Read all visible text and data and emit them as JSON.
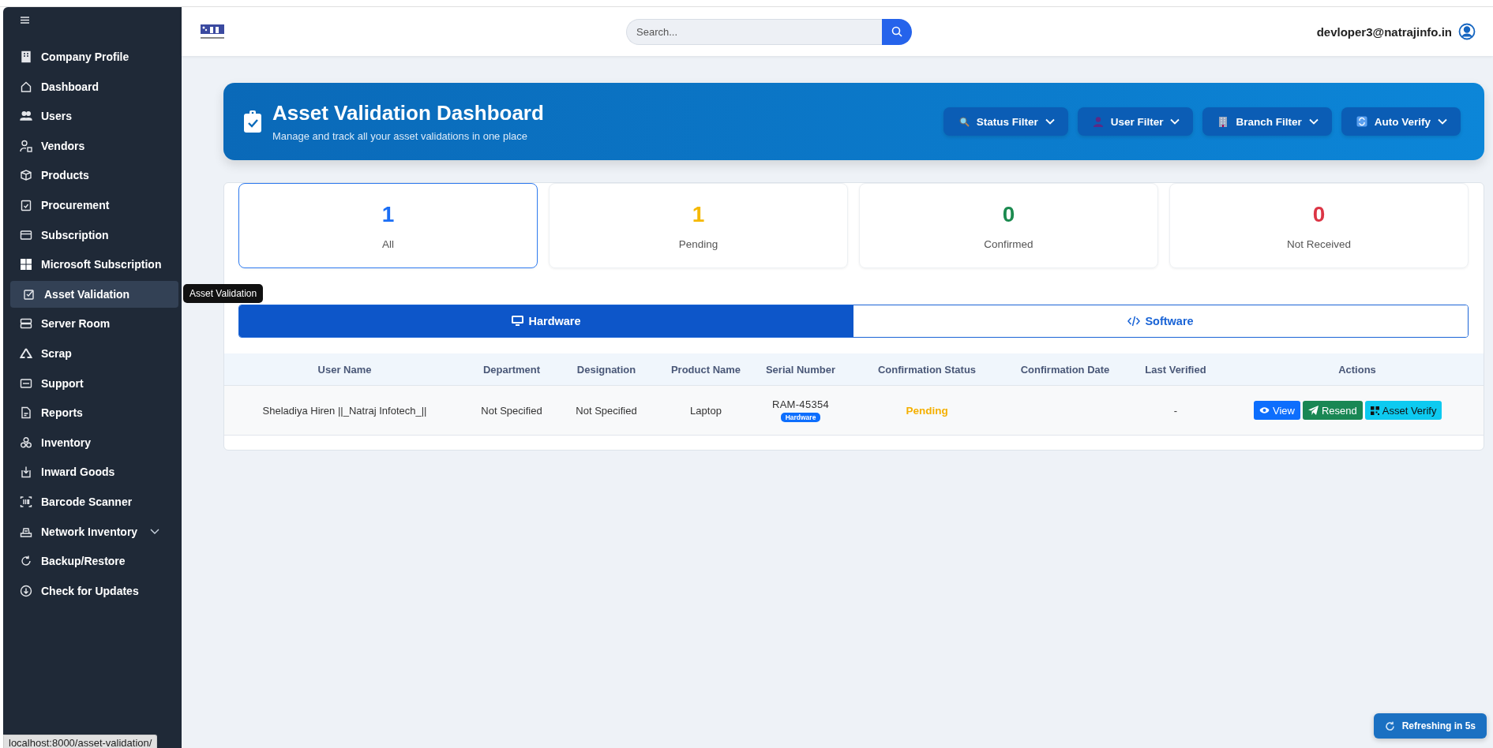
{
  "sidebar": {
    "items": [
      {
        "label": "Company Profile",
        "selected": false
      },
      {
        "label": "Dashboard",
        "selected": false
      },
      {
        "label": "Users",
        "selected": false
      },
      {
        "label": "Vendors",
        "selected": false
      },
      {
        "label": "Products",
        "selected": false
      },
      {
        "label": "Procurement",
        "selected": false
      },
      {
        "label": "Subscription",
        "selected": false
      },
      {
        "label": "Microsoft Subscription",
        "selected": false
      },
      {
        "label": "Asset Validation",
        "selected": true
      },
      {
        "label": "Server Room",
        "selected": false
      },
      {
        "label": "Scrap",
        "selected": false
      },
      {
        "label": "Support",
        "selected": false
      },
      {
        "label": "Reports",
        "selected": false
      },
      {
        "label": "Inventory",
        "selected": false
      },
      {
        "label": "Inward Goods",
        "selected": false
      },
      {
        "label": "Barcode Scanner",
        "selected": false
      },
      {
        "label": "Network Inventory",
        "selected": false,
        "expanded": false
      },
      {
        "label": "Backup/Restore",
        "selected": false
      },
      {
        "label": "Check for Updates",
        "selected": false
      }
    ],
    "tooltip": "Asset Validation"
  },
  "header": {
    "search": {
      "placeholder": "Search..."
    },
    "user_email": "devloper3@natrajinfo.in"
  },
  "banner": {
    "title": "Asset Validation Dashboard",
    "subtitle": "Manage and track all your asset validations in one place",
    "filters": [
      "Status Filter",
      "User Filter",
      "Branch Filter",
      "Auto Verify"
    ]
  },
  "stats": [
    {
      "value": "1",
      "label": "All",
      "color": "#1a6ef5",
      "selected": true
    },
    {
      "value": "1",
      "label": "Pending",
      "color": "#f5b800",
      "selected": false
    },
    {
      "value": "0",
      "label": "Confirmed",
      "color": "#1b8a4f",
      "selected": false
    },
    {
      "value": "0",
      "label": "Not Received",
      "color": "#dc3545",
      "selected": false
    }
  ],
  "tabs": [
    {
      "label": "Hardware",
      "selected": true
    },
    {
      "label": "Software",
      "selected": false
    }
  ],
  "table": {
    "columns": [
      "User Name",
      "Department",
      "Designation",
      "Product Name",
      "Serial Number",
      "Confirmation Status",
      "Confirmation Date",
      "Last Verified",
      "Actions"
    ],
    "rows": [
      {
        "user_name": "Sheladiya Hiren ||_Natraj Infotech_||",
        "department": "Not Specified",
        "designation": "Not Specified",
        "product_name": "Laptop",
        "serial_number": "RAM-45354",
        "type_badge": "Hardware",
        "status": "Pending",
        "confirmation_date": "",
        "last_verified": "-",
        "actions": [
          {
            "label": "View",
            "kind": "view"
          },
          {
            "label": "Resend",
            "kind": "resend"
          },
          {
            "label": "Asset Verify",
            "kind": "verify"
          }
        ]
      }
    ]
  },
  "toast": "Refreshing in 5s",
  "status_url": "localhost:8000/asset-validation/"
}
